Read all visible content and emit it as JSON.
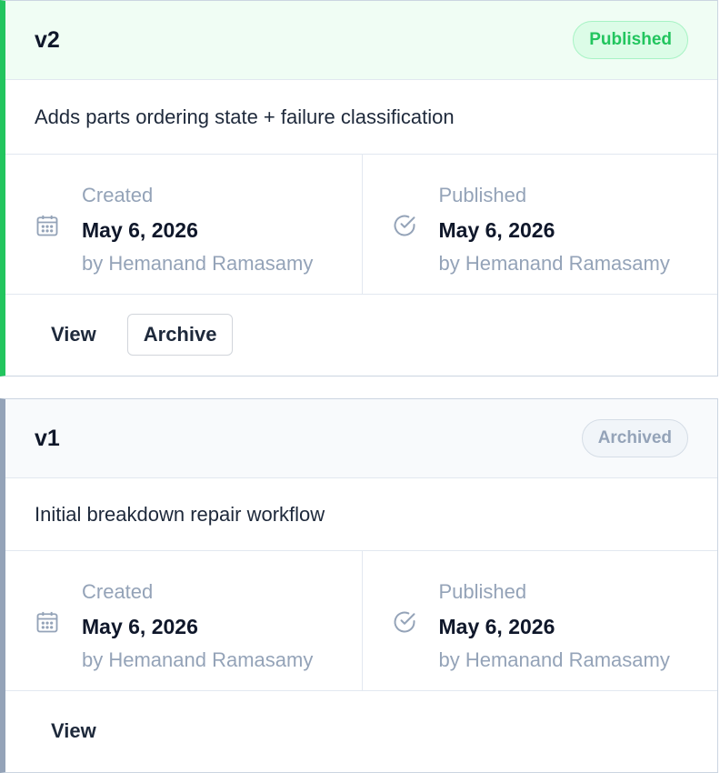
{
  "versions": [
    {
      "version": "v2",
      "status": "Published",
      "description": "Adds parts ordering state + failure classification",
      "created_label": "Created",
      "created_date": "May 6, 2026",
      "created_by": "by Hemanand Ramasamy",
      "published_label": "Published",
      "published_date": "May 6, 2026",
      "published_by": "by Hemanand Ramasamy",
      "view_label": "View",
      "archive_label": "Archive"
    },
    {
      "version": "v1",
      "status": "Archived",
      "description": "Initial breakdown repair workflow",
      "created_label": "Created",
      "created_date": "May 6, 2026",
      "created_by": "by Hemanand Ramasamy",
      "published_label": "Published",
      "published_date": "May 6, 2026",
      "published_by": "by Hemanand Ramasamy",
      "view_label": "View"
    }
  ],
  "colors": {
    "published_accent": "#22c55e",
    "archived_accent": "#94a3b8"
  },
  "icons": {
    "created": "calendar-icon",
    "published": "check-circle-icon"
  }
}
